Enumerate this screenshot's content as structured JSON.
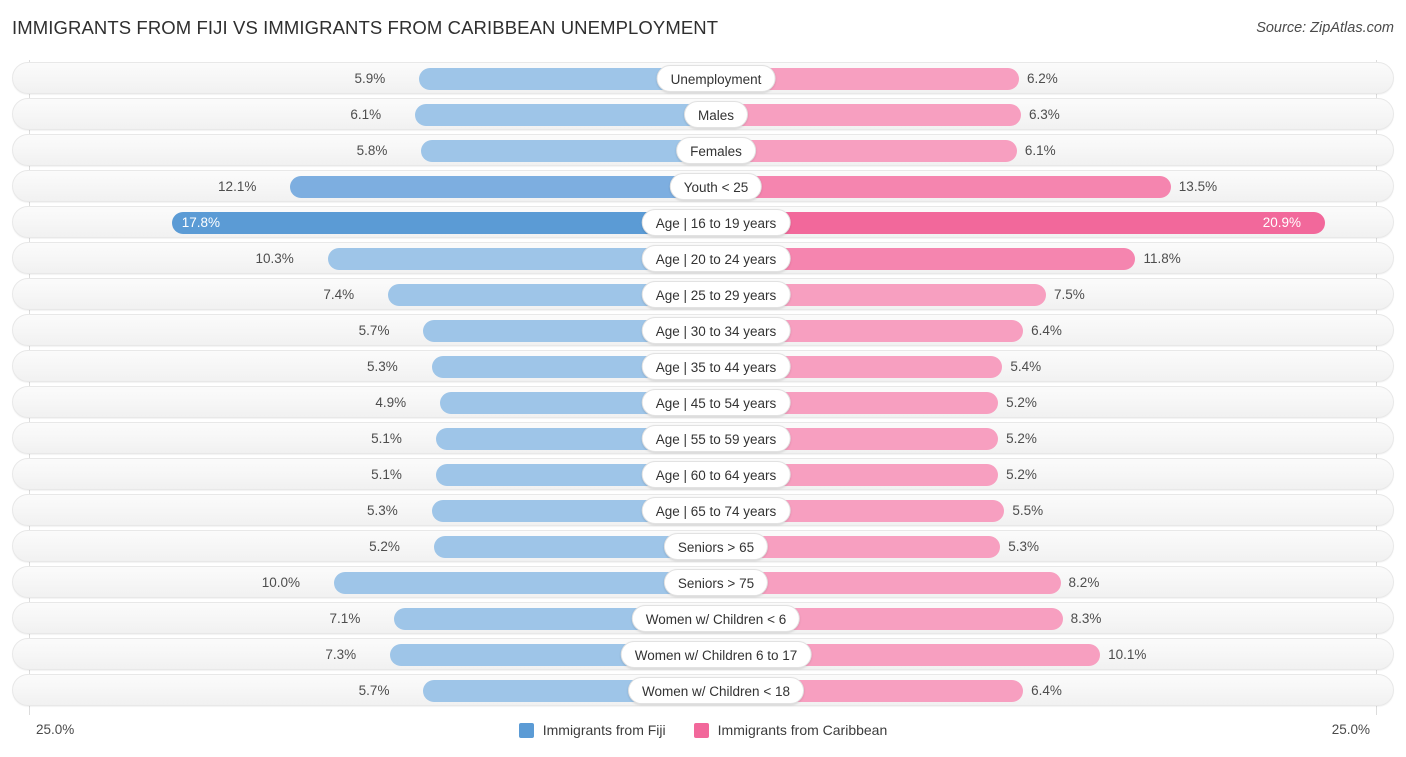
{
  "header": {
    "title": "IMMIGRANTS FROM FIJI VS IMMIGRANTS FROM CARIBBEAN UNEMPLOYMENT",
    "source": "Source: ZipAtlas.com"
  },
  "axis": {
    "left_label": "25.0%",
    "right_label": "25.0%"
  },
  "legend": {
    "items": [
      {
        "label": "Immigrants from Fiji",
        "color": "#5b9bd5"
      },
      {
        "label": "Immigrants from Caribbean",
        "color": "#f2689b"
      }
    ]
  },
  "colors": {
    "left_light": "#9ec5e8",
    "left_mid": "#7daee0",
    "left_strong": "#5b9bd5",
    "right_light": "#f79fc0",
    "right_mid": "#f585af",
    "right_strong": "#f2689b"
  },
  "chart_data": {
    "type": "bar",
    "title": "IMMIGRANTS FROM FIJI VS IMMIGRANTS FROM CARIBBEAN UNEMPLOYMENT",
    "subtitle": "",
    "xlabel": "",
    "ylabel": "",
    "orientation": "horizontal-diverging",
    "axis_max_percent": 25.0,
    "grid": false,
    "legend_position": "bottom-center",
    "categories": [
      "Unemployment",
      "Males",
      "Females",
      "Youth < 25",
      "Age | 16 to 19 years",
      "Age | 20 to 24 years",
      "Age | 25 to 29 years",
      "Age | 30 to 34 years",
      "Age | 35 to 44 years",
      "Age | 45 to 54 years",
      "Age | 55 to 59 years",
      "Age | 60 to 64 years",
      "Age | 65 to 74 years",
      "Seniors > 65",
      "Seniors > 75",
      "Women w/ Children < 6",
      "Women w/ Children 6 to 17",
      "Women w/ Children < 18"
    ],
    "series": [
      {
        "name": "Immigrants from Fiji",
        "side": "left",
        "values": [
          5.9,
          6.1,
          5.8,
          12.1,
          17.8,
          10.3,
          7.4,
          5.7,
          5.3,
          4.9,
          5.1,
          5.1,
          5.3,
          5.2,
          10.0,
          7.1,
          7.3,
          5.7
        ],
        "labels": [
          "5.9%",
          "6.1%",
          "5.8%",
          "12.1%",
          "17.8%",
          "10.3%",
          "7.4%",
          "5.7%",
          "5.3%",
          "4.9%",
          "5.1%",
          "5.1%",
          "5.3%",
          "5.2%",
          "10.0%",
          "7.1%",
          "7.3%",
          "5.7%"
        ]
      },
      {
        "name": "Immigrants from Caribbean",
        "side": "right",
        "values": [
          6.2,
          6.3,
          6.1,
          13.5,
          20.9,
          11.8,
          7.5,
          6.4,
          5.4,
          5.2,
          5.2,
          5.2,
          5.5,
          5.3,
          8.2,
          8.3,
          10.1,
          6.4
        ],
        "labels": [
          "6.2%",
          "6.3%",
          "6.1%",
          "13.5%",
          "20.9%",
          "11.8%",
          "7.5%",
          "6.4%",
          "5.4%",
          "5.2%",
          "5.2%",
          "5.2%",
          "5.5%",
          "5.3%",
          "8.2%",
          "8.3%",
          "10.1%",
          "6.4%"
        ]
      }
    ]
  }
}
